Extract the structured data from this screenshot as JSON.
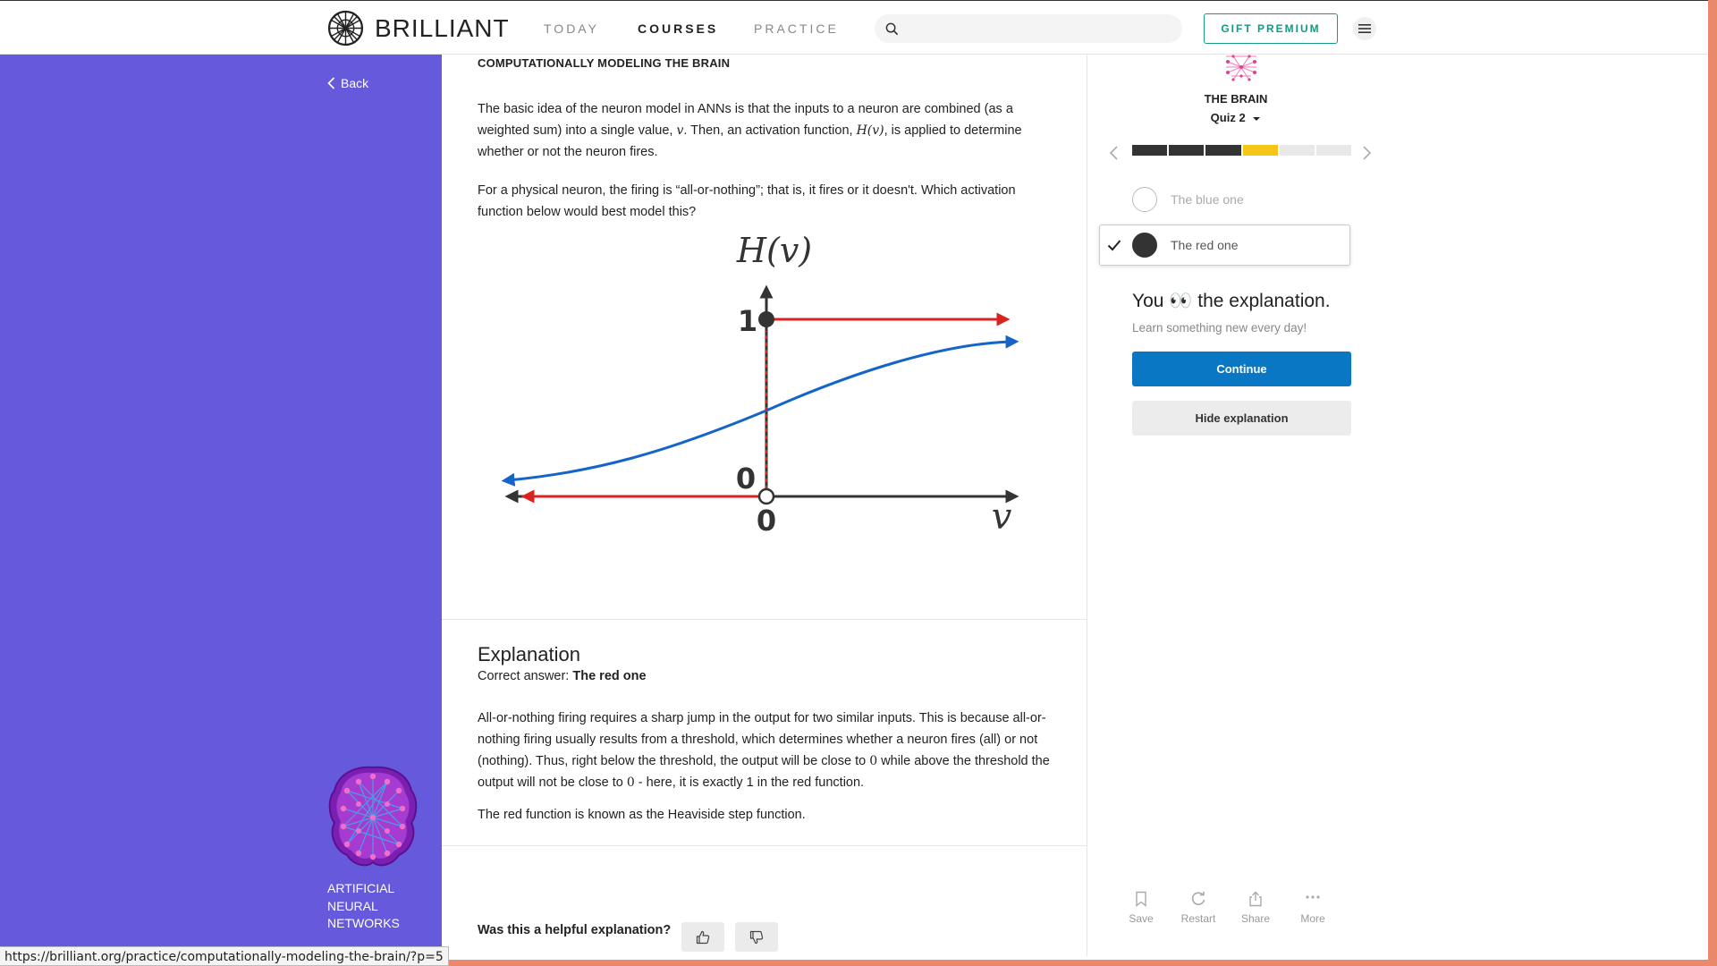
{
  "nav": {
    "brand": "BRILLIANT",
    "links": [
      "TODAY",
      "COURSES",
      "PRACTICE"
    ],
    "active_link": "COURSES",
    "search_placeholder": "",
    "gift_label": "GIFT PREMIUM"
  },
  "sidebar": {
    "back_label": "Back",
    "course_lines": [
      "ARTIFICIAL",
      "NEURAL",
      "NETWORKS"
    ]
  },
  "main": {
    "chapter_title": "COMPUTATIONALLY MODELING THE BRAIN",
    "p1_a": "The basic idea of the neuron model in ANNs is that the inputs to a neuron are combined (as a weighted sum) into a single value, ",
    "p1_v": "v",
    "p1_b": ". Then, an activation function, ",
    "p1_h": "H(v)",
    "p1_c": ", is applied to determine whether or not the neuron fires.",
    "p2": "For a physical neuron, the firing is “all-or-nothing”; that is, it fires or it doesn't. Which activation function below would best model this?",
    "graph": {
      "title": "H(v)",
      "y_one": "1",
      "y_zero": "0",
      "x_zero": "0",
      "x_label": "v",
      "red_color": "#d9231f",
      "blue_color": "#1565c8"
    },
    "explanation": {
      "title": "Explanation",
      "answer_prefix": "Correct answer: ",
      "answer": "The red one",
      "p1_a": "All-or-nothing firing requires a sharp jump in the output for two similar inputs. This is because all-or-nothing firing usually results from a threshold, which determines whether a neuron fires (all) or not (nothing). Thus, right below the threshold, the output will be close to ",
      "p1_zero1": "0",
      "p1_b": " while above the threshold the output will not be close to ",
      "p1_zero2": "0",
      "p1_c": " - here, it is exactly 1 in the red function.",
      "p2": "The red function is known as the Heaviside step function."
    },
    "feedback_question": "Was this a helpful explanation?"
  },
  "quiz": {
    "course": "THE BRAIN",
    "name": "Quiz 2",
    "progress": {
      "done": 3,
      "current": 4,
      "total": 6
    },
    "options": [
      {
        "label": "The blue one",
        "selected": false
      },
      {
        "label": "The red one",
        "selected": true
      }
    ],
    "you_before": "You ",
    "you_emoji": "👀",
    "you_after": " the explanation.",
    "subtitle": "Learn something new every day!",
    "continue_label": "Continue",
    "hide_label": "Hide explanation"
  },
  "toolbar": {
    "save": "Save",
    "restart": "Restart",
    "share": "Share",
    "more": "More"
  },
  "status_url": "https://brilliant.org/practice/computationally-modeling-the-brain/?p=5",
  "colors": {
    "sidebar": "#6559dc",
    "accent_green": "#149a84",
    "continue_blue": "#0a77c5",
    "progress_current": "#f5c518"
  }
}
